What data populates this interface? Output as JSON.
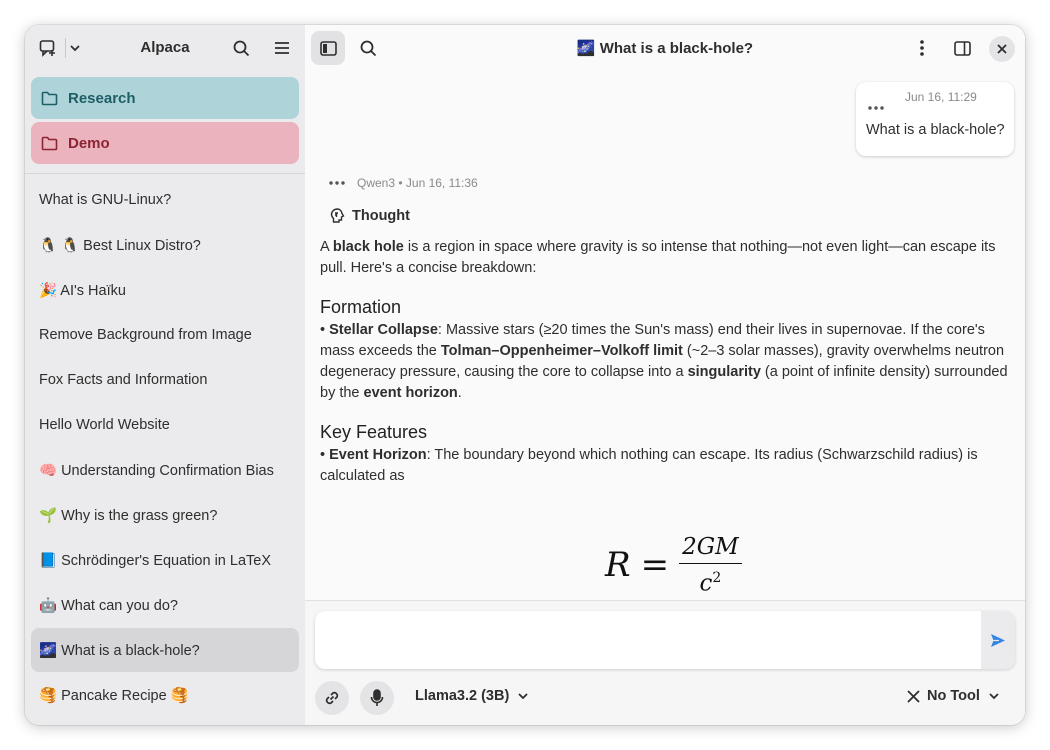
{
  "sidebar": {
    "title": "Alpaca",
    "folders": [
      {
        "label": "Research",
        "color": "#aed4da"
      },
      {
        "label": "Demo",
        "color": "#ebb3bd"
      }
    ],
    "chats": [
      "What is GNU-Linux?",
      "🐧 🐧 Best Linux Distro?",
      "🎉 AI's Haïku",
      "Remove Background from Image",
      "Fox Facts and Information",
      "Hello World Website",
      "🧠 Understanding Confirmation Bias",
      "🌱 Why is the grass green?",
      "📘 Schrödinger's Equation in LaTeX",
      "🤖 What can you do?",
      "🌌 What is a black-hole?",
      "🥞 Pancake Recipe 🥞"
    ],
    "selected_chat": "🌌 What is a black-hole?"
  },
  "main": {
    "title": "🌌 What is a black-hole?",
    "user_message": {
      "timestamp": "Jun 16, 11:29",
      "text": "What is a black-hole?"
    },
    "bot_message": {
      "meta": "Qwen3 • Jun 16, 11:36",
      "thought_label": "Thought",
      "intro_1": "A ",
      "intro_bold": "black hole",
      "intro_2": " is a region in space where gravity is so intense that nothing—not even light—can escape its pull. Here's a concise breakdown:",
      "h_formation": "Formation",
      "f_bullet": "• ",
      "f_bold1": "Stellar Collapse",
      "f_t1": ": Massive stars (≥20 times the Sun's mass) end their lives in supernovae. If the core's mass exceeds the ",
      "f_bold2": "Tolman–Oppenheimer–Volkoff limit",
      "f_t2": " (~2–3 solar masses), gravity overwhelms neutron degeneracy pressure, causing the core to collapse into a ",
      "f_bold3": "singularity",
      "f_t3": " (a point of infinite density) surrounded by the ",
      "f_bold4": "event horizon",
      "f_t4": ".",
      "h_features": "Key Features",
      "k_bullet": "• ",
      "k_bold1": "Event Horizon",
      "k_t1": ": The boundary beyond which nothing can escape. Its radius (Schwarzschild radius) is calculated as",
      "formula": {
        "lhs": "R",
        "eq": "=",
        "num": "2GM",
        "den": "c",
        "den_exp": "2"
      }
    }
  },
  "composer": {
    "placeholder": "",
    "model": "Llama3.2 (3B)",
    "tool": "No Tool"
  },
  "colors": {
    "accent": "#3584e4"
  },
  "icons": [
    "new-chat-icon",
    "chevron-down-icon",
    "search-icon",
    "hamburger-menu-icon",
    "folder-icon",
    "sidebar-toggle-icon",
    "kebab-menu-icon",
    "split-view-icon",
    "close-icon",
    "more-dots-icon",
    "thought-icon",
    "send-icon",
    "attachment-icon",
    "microphone-icon",
    "x-icon"
  ]
}
